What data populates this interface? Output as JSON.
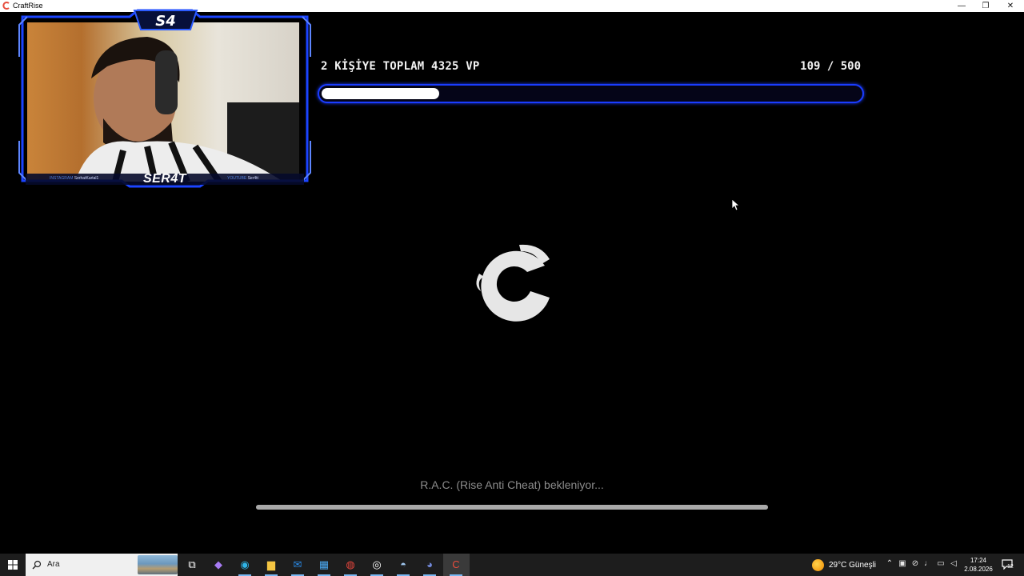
{
  "window": {
    "title": "CraftRise",
    "controls": {
      "minimize": "—",
      "maximize": "❐",
      "close": "✕"
    }
  },
  "stream_overlay": {
    "brand": "SER4T",
    "instagram_label": "INSTAGRAM",
    "instagram_handle": "SerhatKartal1",
    "youtube_label": "YOUTUBE",
    "youtube_handle": "Ser4tt"
  },
  "goal": {
    "title": "2 KİŞİYE TOPLAM 4325 VP",
    "count_text": "109 / 500",
    "current": 109,
    "target": 500,
    "fill_fraction": 0.218
  },
  "loader": {
    "status_text": "R.A.C. (Rise Anti Cheat) bekleniyor...",
    "progress": 1.0
  },
  "taskbar": {
    "search_placeholder": "Ara",
    "apps": [
      {
        "name": "task-view-icon",
        "glyph": "⧉",
        "color": "#ffffff"
      },
      {
        "name": "copilot-icon",
        "glyph": "◆",
        "color": "#a77bf3"
      },
      {
        "name": "edge-icon",
        "glyph": "◉",
        "color": "#2fb4e8"
      },
      {
        "name": "file-explorer-icon",
        "glyph": "▆",
        "color": "#f4c542"
      },
      {
        "name": "outlook-icon",
        "glyph": "✉",
        "color": "#2a8ae6"
      },
      {
        "name": "store-icon",
        "glyph": "▦",
        "color": "#4aa8f0"
      },
      {
        "name": "chrome-icon",
        "glyph": "◍",
        "color": "#e9463d"
      },
      {
        "name": "gog-icon",
        "glyph": "◎",
        "color": "#ffffff"
      },
      {
        "name": "steam-icon",
        "glyph": "◓",
        "color": "#9fc6ee"
      },
      {
        "name": "discord-icon",
        "glyph": "◕",
        "color": "#7289da"
      },
      {
        "name": "craftrise-icon",
        "glyph": "C",
        "color": "#e74c3c"
      }
    ],
    "weather": {
      "text": "29°C  Güneşli"
    },
    "tray_icons": [
      {
        "name": "show-hidden-icons-icon",
        "glyph": "⌃"
      },
      {
        "name": "teams-meet-icon",
        "glyph": "▣"
      },
      {
        "name": "camera-off-icon",
        "glyph": "⊘"
      },
      {
        "name": "microphone-icon",
        "glyph": "♩"
      },
      {
        "name": "network-icon",
        "glyph": "▭"
      },
      {
        "name": "volume-icon",
        "glyph": "◁"
      }
    ],
    "time": "17:24",
    "date": "2.08.2026",
    "notification_count": "12"
  },
  "colors": {
    "goal_bar_border": "#1a3cff",
    "goal_bar_fill": "#ffffff",
    "background": "#000000",
    "status_text": "#8c8c8c"
  }
}
